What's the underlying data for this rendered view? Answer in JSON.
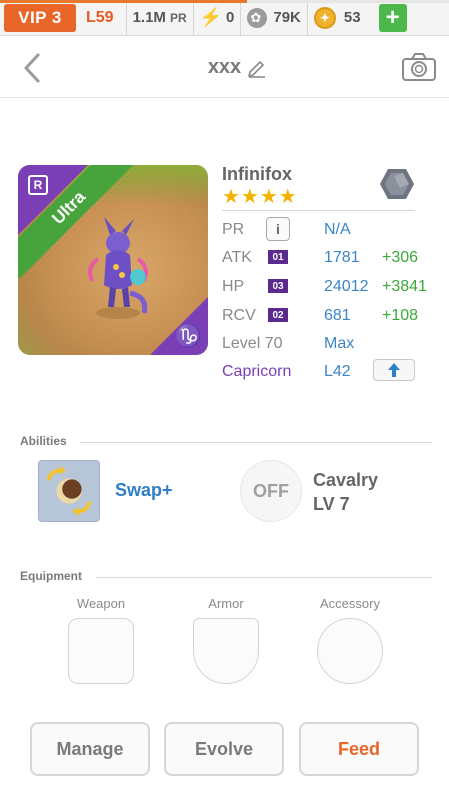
{
  "status": {
    "vip": "VIP 3",
    "level": "L59",
    "power": "1.1M",
    "power_unit": "PR",
    "energy": "0",
    "food": "79K",
    "coins": "53",
    "xp_progress": 0.55,
    "accent": "#e8662a"
  },
  "header": {
    "title": "xxx",
    "icons": [
      "chevron-left-icon",
      "pencil-icon",
      "camera-icon"
    ]
  },
  "pet": {
    "name": "Infinifox",
    "stars": "★★★★",
    "rarity": "Ultra",
    "rarity_color": "#47a43c",
    "rank_badge": "R",
    "zodiac_glyph": "♑",
    "zodiac_color": "#7b3fb5",
    "stats": [
      {
        "label": "PR",
        "value": "N/A",
        "bonus": ""
      },
      {
        "label": "ATK",
        "tag": "01",
        "value": "1781",
        "bonus": "+306"
      },
      {
        "label": "HP",
        "tag": "03",
        "value": "24012",
        "bonus": "+3841"
      },
      {
        "label": "RCV",
        "tag": "02",
        "value": "681",
        "bonus": "+108"
      }
    ],
    "level_label": "Level 70",
    "level_value": "Max",
    "sign_label": "Capricorn",
    "sign_value": "L42"
  },
  "abilities": {
    "title": "Abilities",
    "primary": "Swap+",
    "secondary_state": "OFF",
    "secondary_name": "Cavalry",
    "secondary_level": "LV 7"
  },
  "equipment": {
    "title": "Equipment",
    "slots": [
      "Weapon",
      "Armor",
      "Accessory"
    ]
  },
  "actions": {
    "manage": "Manage",
    "evolve": "Evolve",
    "feed": "Feed"
  }
}
